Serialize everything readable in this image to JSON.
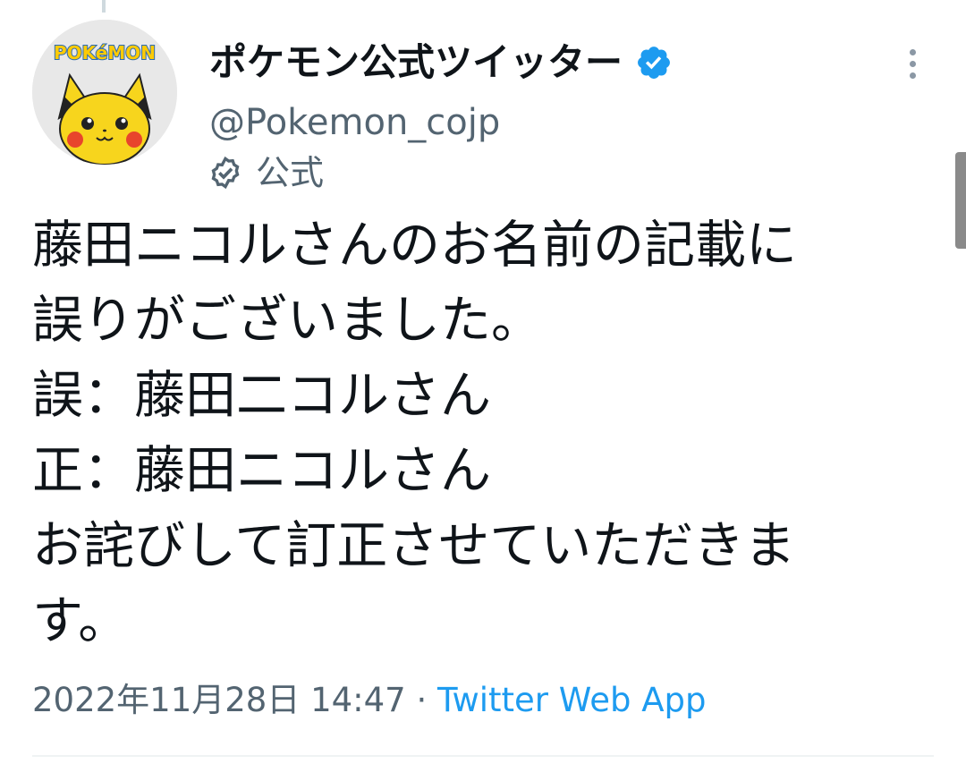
{
  "user": {
    "display_name": "ポケモン公式ツイッター",
    "handle": "@Pokemon_cojp",
    "official_label": "公式",
    "avatar_logo_text": "POKéMON"
  },
  "tweet": {
    "lines": [
      "藤田ニコルさんのお名前の記載に",
      "誤りがございました。",
      "誤：藤田二コルさん",
      "正：藤田ニコルさん",
      "お詫びして訂正させていただきま",
      "す。"
    ],
    "timestamp": "2022年11月28日 14:47",
    "separator": " · ",
    "source": "Twitter Web App"
  },
  "colors": {
    "verified": "#1d9bf0",
    "link": "#1d9bf0",
    "secondary_text": "#536471"
  },
  "icons": {
    "verified": "verified-badge-icon",
    "official": "official-label-icon",
    "more": "more-options-icon"
  }
}
